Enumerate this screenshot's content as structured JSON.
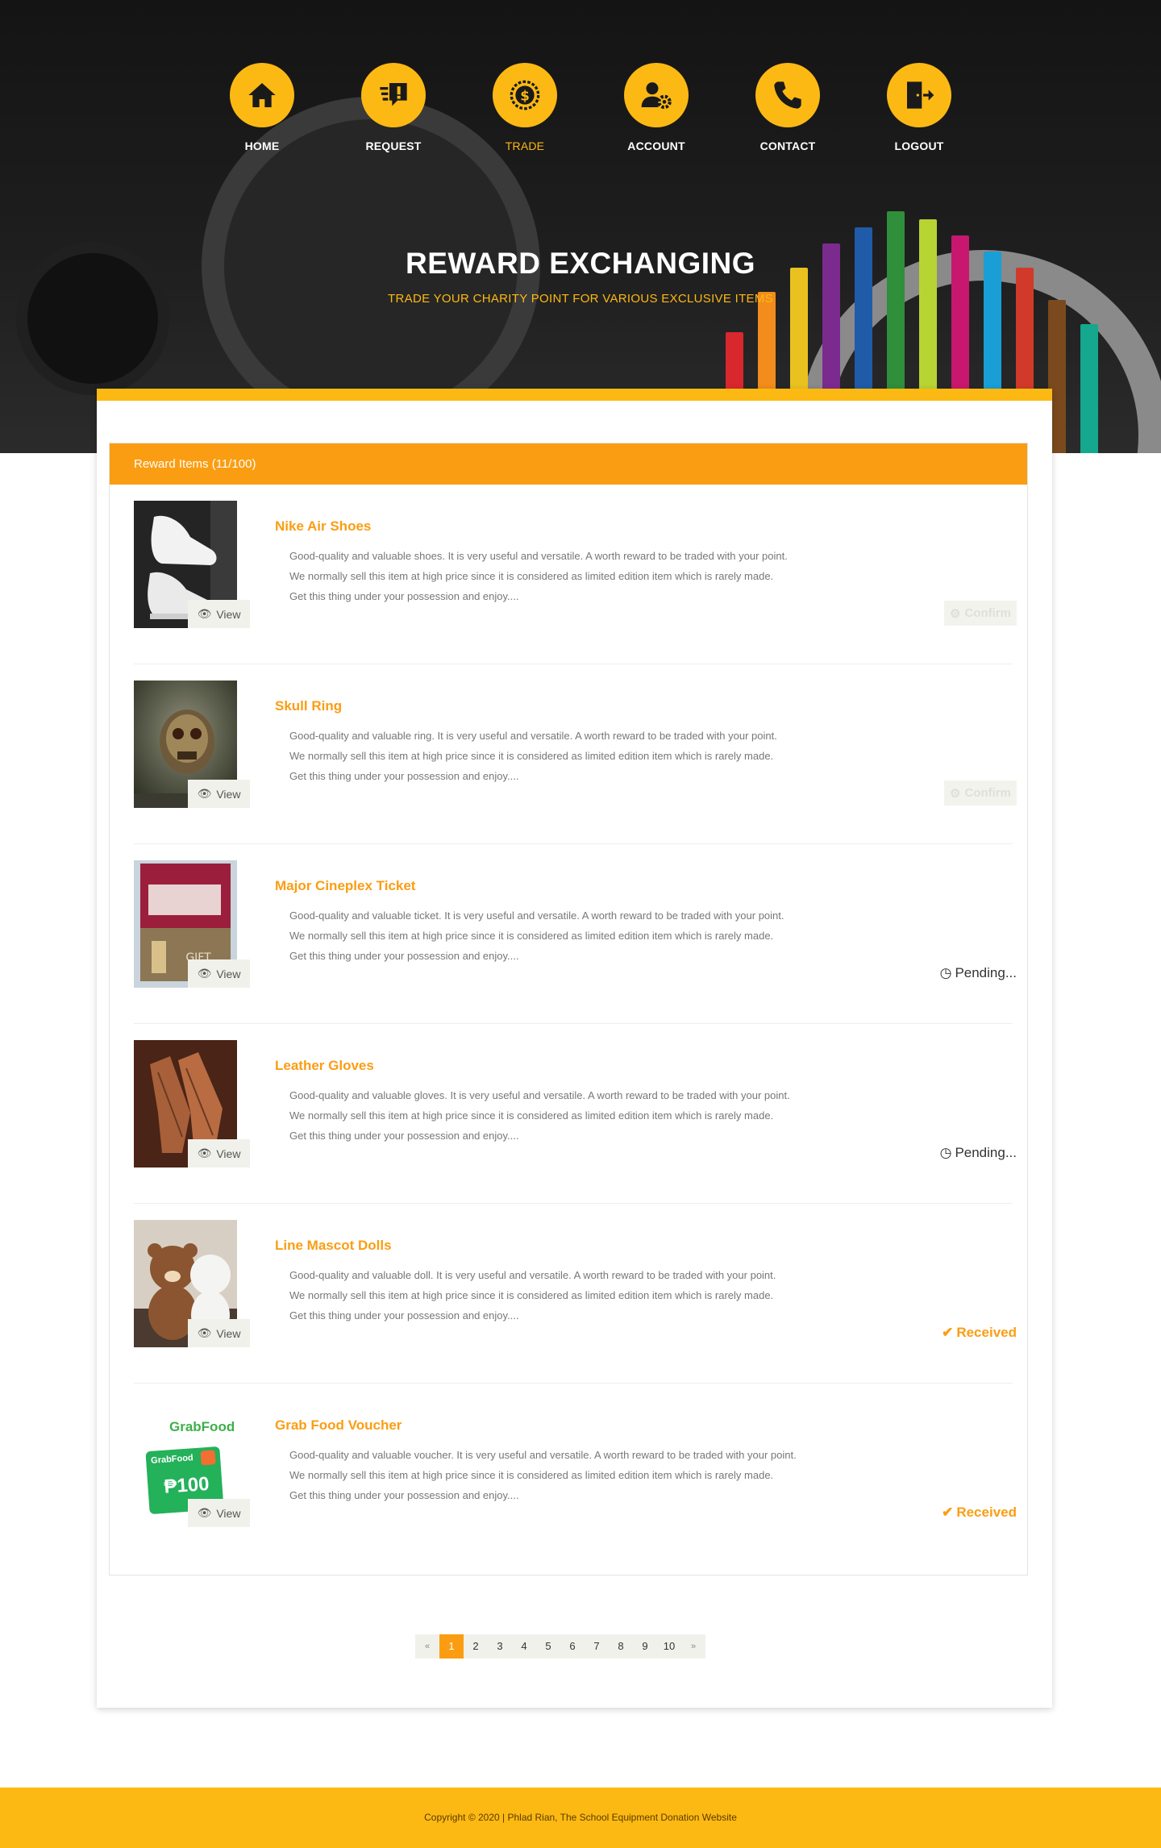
{
  "nav": {
    "items": [
      {
        "label": "HOME",
        "icon": "home-icon"
      },
      {
        "label": "REQUEST",
        "icon": "request-icon"
      },
      {
        "label": "TRADE",
        "icon": "trade-coin-icon",
        "active": true
      },
      {
        "label": "ACCOUNT",
        "icon": "account-settings-icon"
      },
      {
        "label": "CONTACT",
        "icon": "phone-icon"
      },
      {
        "label": "LOGOUT",
        "icon": "logout-door-icon"
      }
    ]
  },
  "hero": {
    "title": "REWARD EXCHANGING",
    "subtitle": "TRADE YOUR CHARITY POINT FOR VARIOUS EXCLUSIVE ITEMS"
  },
  "panel": {
    "header": "Reward Items (11/100)"
  },
  "items": [
    {
      "title": "Nike Air Shoes",
      "desc": [
        "Good-quality and valuable shoes. It is very useful and versatile. A worth reward to be traded with your point.",
        "We normally sell this item at high price since it is considered as limited edition item which is rarely made.",
        "Get this thing under your possession and enjoy...."
      ],
      "view_label": "View",
      "action": "confirm",
      "action_label": "Confirm"
    },
    {
      "title": "Skull Ring",
      "desc": [
        "Good-quality and valuable ring. It is very useful and versatile. A worth reward to be traded with your point.",
        "We normally sell this item at high price since it is considered as limited edition item which is rarely made.",
        "Get this thing under your possession and enjoy...."
      ],
      "view_label": "View",
      "action": "confirm",
      "action_label": "Confirm"
    },
    {
      "title": "Major Cineplex Ticket",
      "desc": [
        "Good-quality and valuable ticket. It is very useful and versatile. A worth reward to be traded with your point.",
        "We normally sell this item at high price since it is considered as limited edition item which is rarely made.",
        "Get this thing under your possession and enjoy...."
      ],
      "view_label": "View",
      "action": "pending",
      "action_label": "Pending..."
    },
    {
      "title": "Leather Gloves",
      "desc": [
        "Good-quality and valuable gloves. It is very useful and versatile. A worth reward to be traded with your point.",
        "We normally sell this item at high price since it is considered as limited edition item which is rarely made.",
        "Get this thing under your possession and enjoy...."
      ],
      "view_label": "View",
      "action": "pending",
      "action_label": "Pending..."
    },
    {
      "title": "Line Mascot Dolls",
      "desc": [
        "Good-quality and valuable doll. It is very useful and versatile. A worth reward to be traded with your point.",
        "We normally sell this item at high price since it is considered as limited edition item which is rarely made.",
        "Get this thing under your possession and enjoy...."
      ],
      "view_label": "View",
      "action": "received",
      "action_label": "Received"
    },
    {
      "title": "Grab Food Voucher",
      "desc": [
        "Good-quality and valuable voucher. It is very useful and versatile. A worth reward to be traded with your point.",
        "We normally sell this item at high price since it is considered as limited edition item which is rarely made.",
        "Get this thing under your possession and enjoy...."
      ],
      "view_label": "View",
      "action": "received",
      "action_label": "Received",
      "image_text": {
        "brand": "GrabFood",
        "card_brand": "GrabFood",
        "amount": "₱100"
      }
    }
  ],
  "pagination": {
    "prev": "«",
    "pages": [
      "1",
      "2",
      "3",
      "4",
      "5",
      "6",
      "7",
      "8",
      "9",
      "10"
    ],
    "active": "1",
    "next": "»"
  },
  "footer": {
    "copyright": "Copyright © 2020 | Phlad Rian, The School Equipment Donation Website"
  },
  "colors": {
    "accent_yellow": "#fdb913",
    "accent_orange": "#fb9d12",
    "hero_dark": "#1a1a1a"
  }
}
